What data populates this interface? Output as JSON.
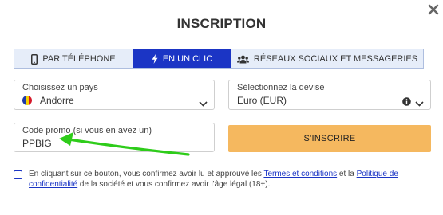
{
  "header": {
    "title": "INSCRIPTION"
  },
  "tabs": [
    {
      "label": "PAR TÉLÉPHONE",
      "icon": "phone-icon",
      "active": false
    },
    {
      "label": "EN UN CLIC",
      "icon": "lightning-icon",
      "active": true
    },
    {
      "label": "RÉSEAUX SOCIAUX ET MESSAGERIES",
      "icon": "users-icon",
      "active": false
    }
  ],
  "form": {
    "country": {
      "label": "Choisissez un pays",
      "value": "Andorre"
    },
    "currency": {
      "label": "Sélectionnez la devise",
      "value": "Euro (EUR)"
    },
    "promo": {
      "label": "Code promo (si vous en avez un)",
      "value": "PPBIG"
    },
    "submit_label": "S'INSCRIRE"
  },
  "consent": {
    "text_before": "En cliquant sur ce bouton, vous confirmez avoir lu et approuvé les ",
    "link_terms": "Termes et conditions",
    "text_middle": " et la ",
    "link_privacy_part1": "Politique de",
    "link_privacy_part2": "confidentialité",
    "text_after": " de la société et vous confirmez avoir l'âge légal (18+)."
  },
  "colors": {
    "accent": "#1b35c5",
    "submit": "#f5b85f",
    "annotation_arrow": "#2ecc1a",
    "tab_inactive_bg": "#e6edf9"
  }
}
